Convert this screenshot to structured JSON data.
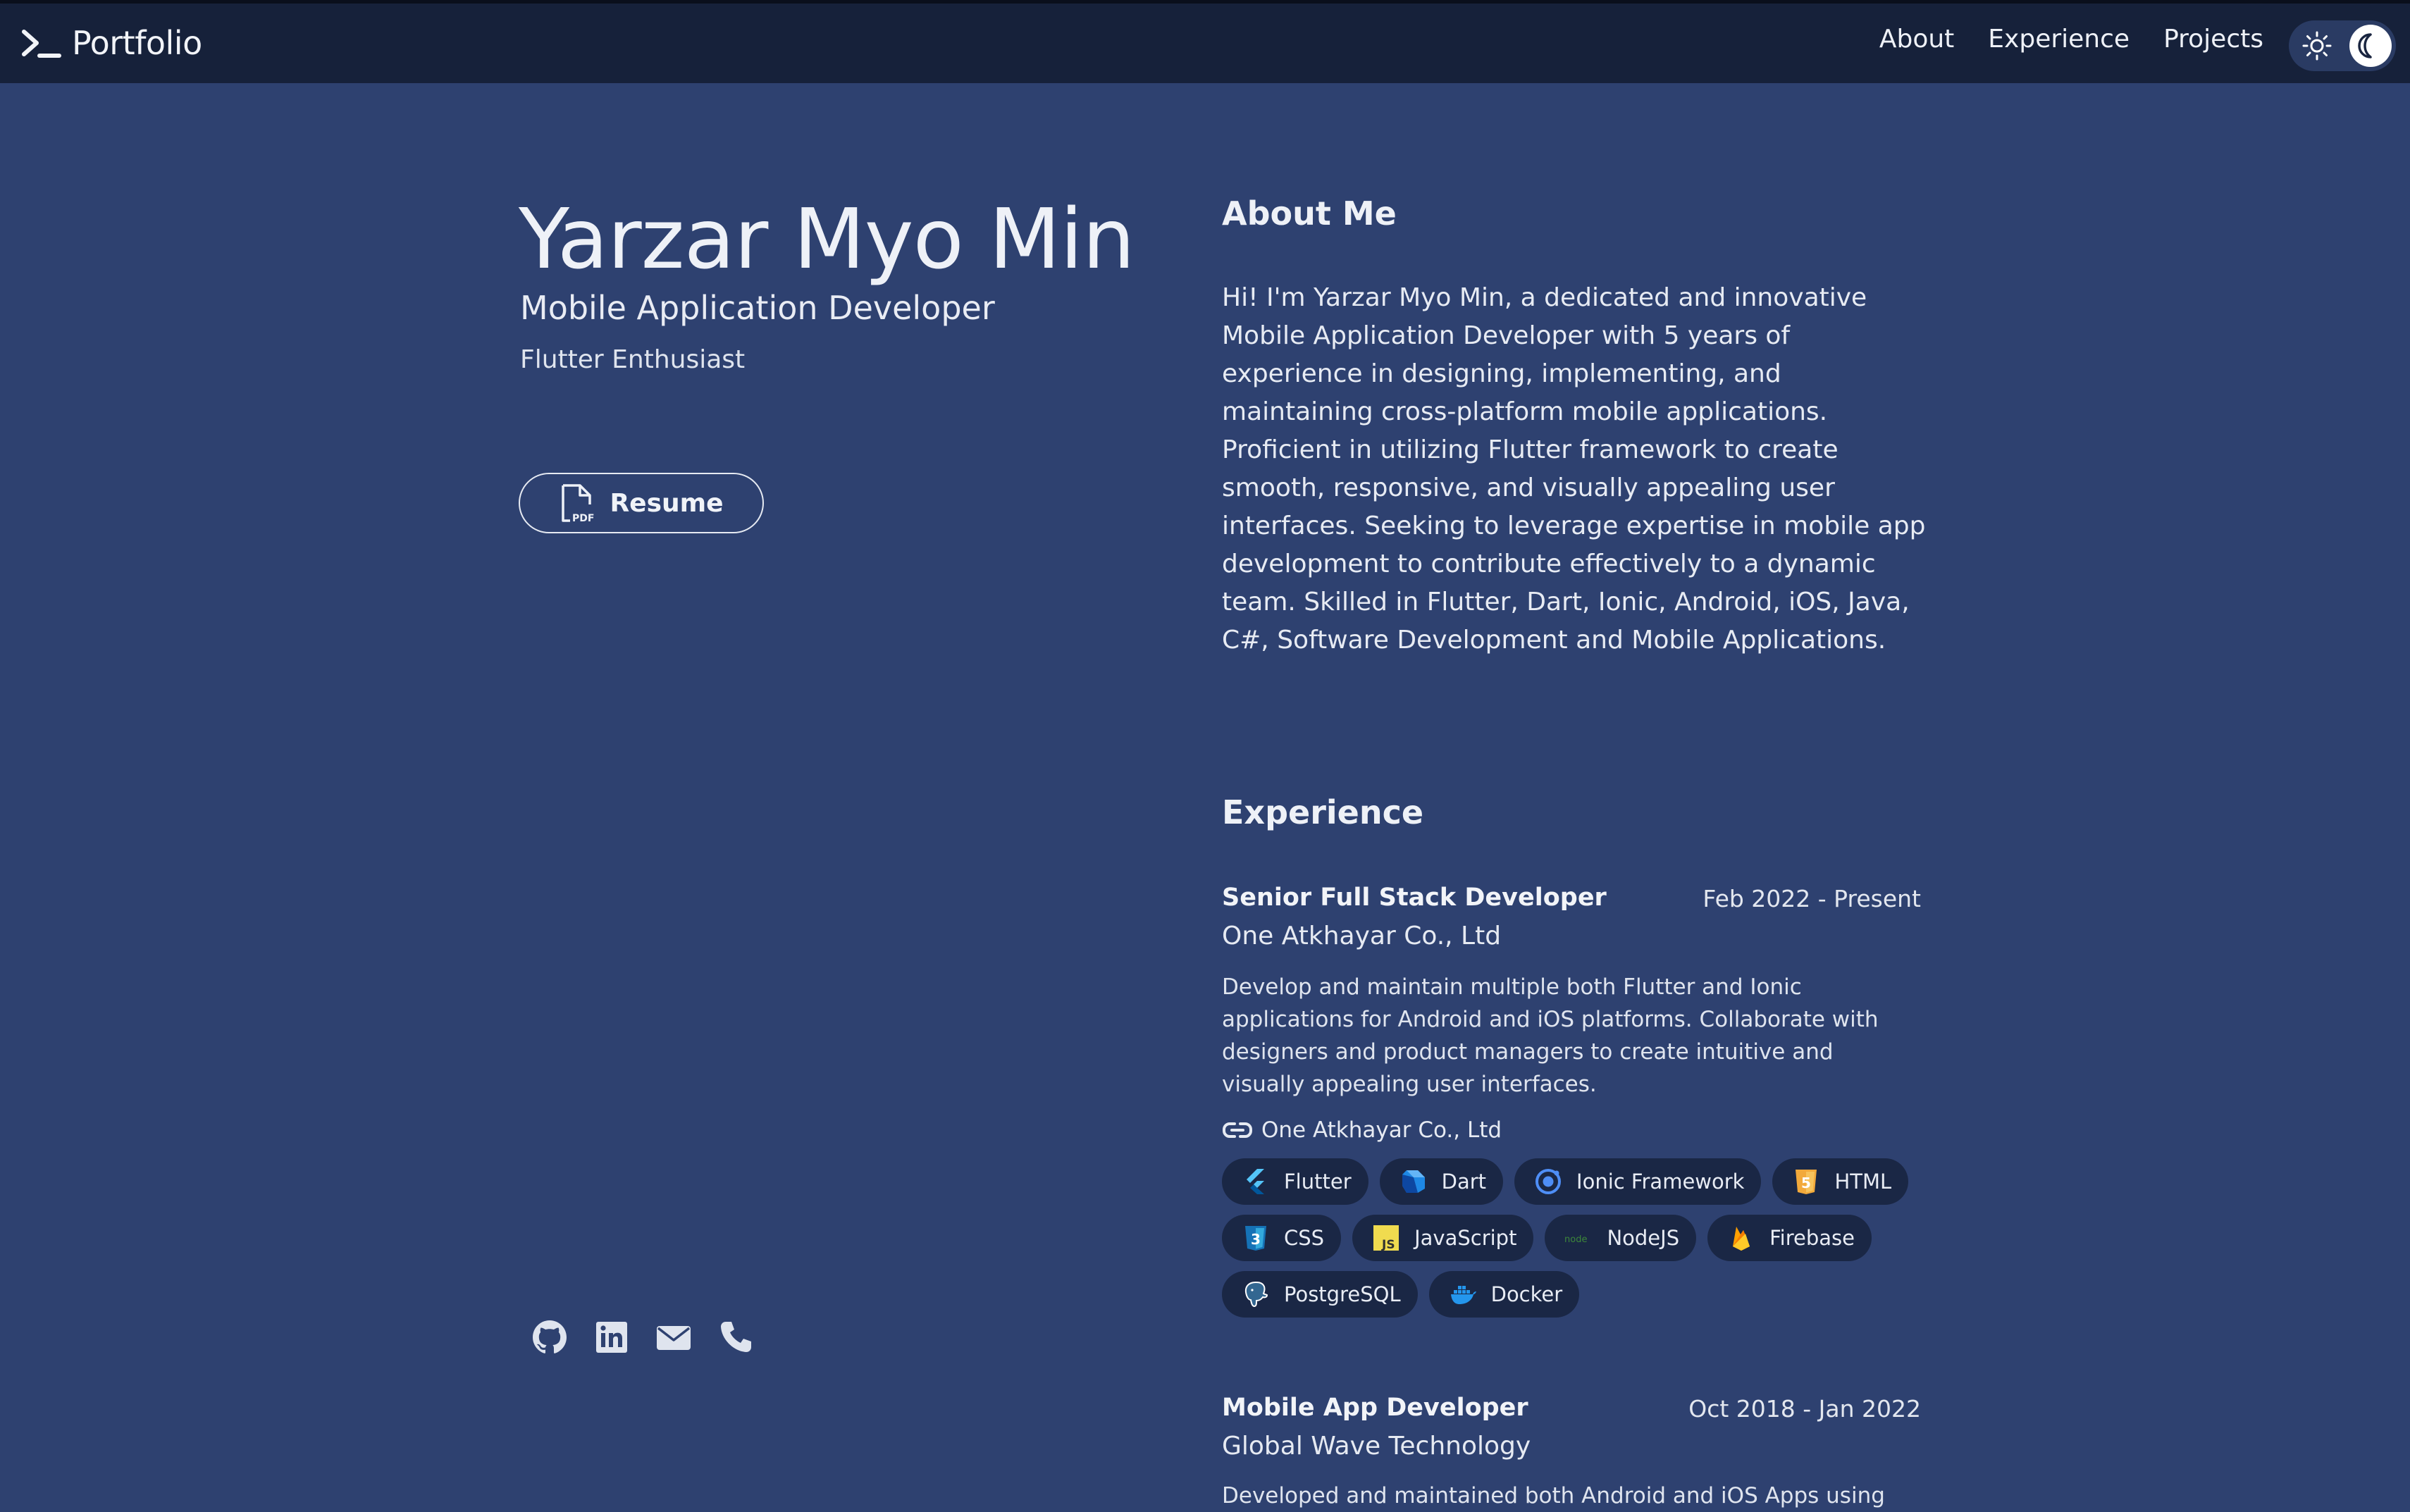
{
  "header": {
    "brand": "Portfolio",
    "nav": [
      "About",
      "Experience",
      "Projects"
    ]
  },
  "profile": {
    "name": "Yarzar Myo Min",
    "role": "Mobile Application Developer",
    "tagline": "Flutter Enthusiast",
    "resume_label": "Resume"
  },
  "about": {
    "heading": "About Me",
    "text": "Hi! I'm Yarzar Myo Min, a dedicated and innovative Mobile Application Developer with 5 years of experience in designing, implementing, and maintaining cross-platform mobile applications. Proficient in utilizing Flutter framework to create smooth, responsive, and visually appealing user interfaces. Seeking to leverage expertise in mobile app development to contribute effectively to a dynamic team. Skilled in Flutter, Dart, Ionic, Android, iOS, Java, C#, Software Development and Mobile Applications."
  },
  "experience": {
    "heading": "Experience",
    "jobs": [
      {
        "title": "Senior Full Stack Developer",
        "date": "Feb 2022 - Present",
        "company": "One Atkhayar Co., Ltd",
        "description": "Develop and maintain multiple both Flutter and Ionic applications for Android and iOS platforms. Collaborate with designers and product managers to create intuitive and visually appealing user interfaces.",
        "link_text": "One Atkhayar Co., Ltd",
        "skills": [
          "Flutter",
          "Dart",
          "Ionic Framework",
          "HTML",
          "CSS",
          "JavaScript",
          "NodeJS",
          "Firebase",
          "PostgreSQL",
          "Docker"
        ]
      },
      {
        "title": "Mobile App Developer",
        "date": "Oct 2018 - Jan 2022",
        "company": "Global Wave Technology",
        "description": "Developed and maintained both Android and iOS Apps using"
      }
    ]
  },
  "icons": {
    "brand": "terminal-prompt-icon",
    "theme": [
      "sun-icon",
      "moon-icon"
    ],
    "resume": "pdf-file-icon",
    "socials": [
      "github-icon",
      "linkedin-icon",
      "email-icon",
      "phone-icon"
    ],
    "job_link": "link-icon"
  },
  "colors": {
    "background": "#2e4170",
    "header": "#16213a",
    "chip": "#1a2745",
    "text": "#e8ecf5"
  }
}
